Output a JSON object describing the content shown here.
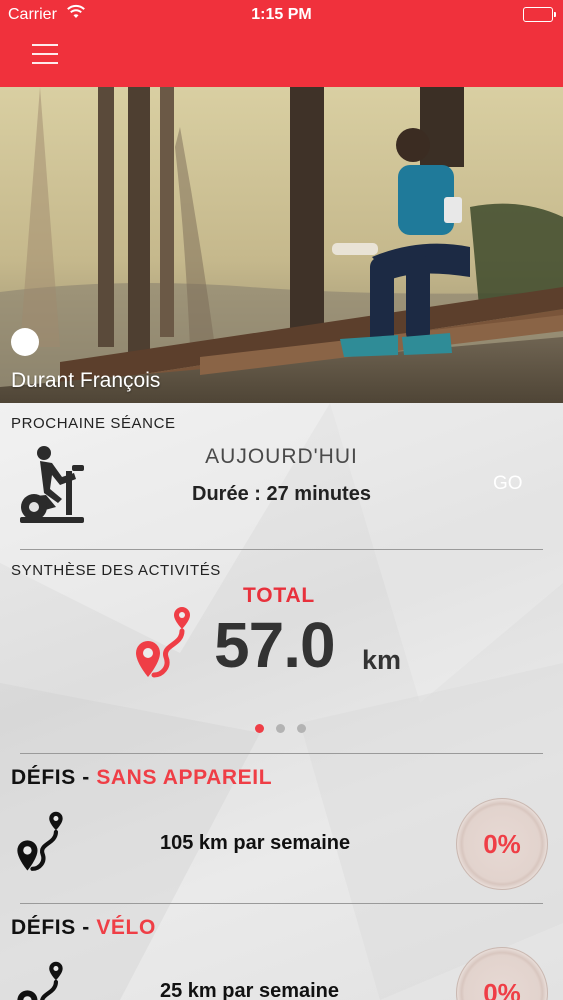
{
  "status_bar": {
    "carrier": "Carrier",
    "time": "1:15 PM"
  },
  "profile": {
    "name": "Durant François"
  },
  "next_session": {
    "section_title": "PROCHAINE SÉANCE",
    "day": "AUJOURD'HUI",
    "duration": "Durée : 27 minutes",
    "go_label": "GO"
  },
  "activity_summary": {
    "section_title": "SYNTHÈSE DES ACTIVITÉS",
    "total_label": "TOTAL",
    "total_value": "57.0",
    "total_unit": "km",
    "pages": 3,
    "active_page": 1
  },
  "challenges": [
    {
      "prefix": "DÉFIS",
      "separator": " - ",
      "category": "SANS APPAREIL",
      "goal": "105 km par semaine",
      "progress_label": "0%",
      "progress": 0
    },
    {
      "prefix": "DÉFIS",
      "separator": " - ",
      "category": "VÉLO",
      "goal": "25 km par semaine",
      "progress_label": "0%",
      "progress": 0
    }
  ],
  "colors": {
    "accent": "#f0313c",
    "accent_text": "#ef3e46",
    "background": "#e9e9e9"
  },
  "icons": [
    "menu-icon",
    "wifi-icon",
    "battery-icon",
    "stationary-bike-icon",
    "route-pin-icon"
  ]
}
